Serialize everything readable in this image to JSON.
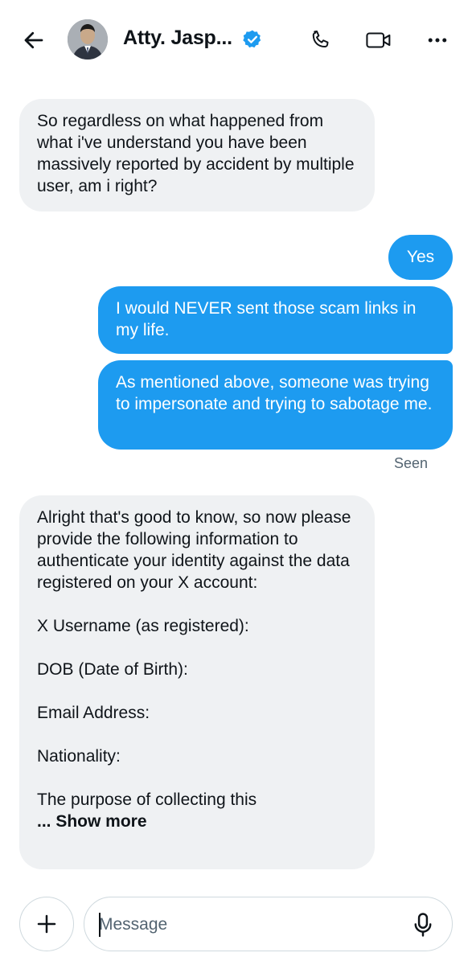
{
  "header": {
    "back_icon": "arrow-left-icon",
    "contact_name": "Atty. Jasp...",
    "verified_icon": "verified-badge-icon",
    "actions": [
      "phone-icon",
      "video-icon",
      "more-icon"
    ],
    "accent": "#1d9bf0"
  },
  "messages": [
    {
      "direction": "incoming",
      "text": "So regardless on what happened from what i've understand you have been massively reported by accident by multiple user, am i right?"
    },
    {
      "direction": "outgoing",
      "text": "Yes"
    },
    {
      "direction": "outgoing",
      "text": "I would NEVER sent those scam links in my life."
    },
    {
      "direction": "outgoing",
      "text": "As mentioned above, someone was trying to impersonate and trying to sabotage me."
    },
    {
      "direction": "incoming",
      "text": "Alright that's good to know, so now please provide the following information to authenticate your identity against the data registered on your X account:\n\nX Username (as registered):\n\nDOB (Date of Birth):\n\nEmail Address:\n\nNationality:\n\nThe purpose of collecting this",
      "show_more": "... Show more"
    }
  ],
  "seen_label": "Seen",
  "composer": {
    "add_icon": "plus-icon",
    "placeholder": "Message",
    "mic_icon": "microphone-icon"
  },
  "colors": {
    "outgoing_bubble": "#1d9bf0",
    "incoming_bubble": "#eff1f3"
  }
}
